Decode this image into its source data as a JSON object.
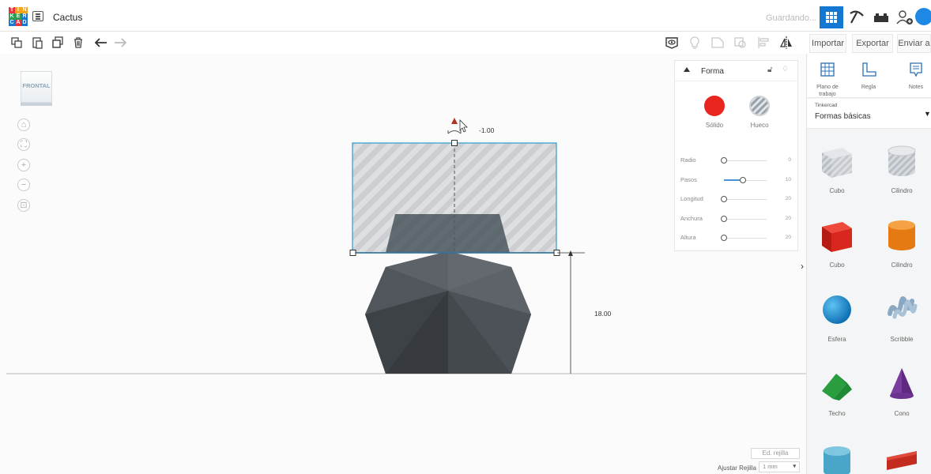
{
  "header": {
    "logo_letters": [
      "T",
      "I",
      "N",
      "K",
      "E",
      "R",
      "C",
      "A",
      "D"
    ],
    "logo_colors": [
      "#e8343a",
      "#f6a21b",
      "#f6a21b",
      "#2f9d52",
      "#2f9d52",
      "#1477d1",
      "#1477d1",
      "#e8343a",
      "#1477d1"
    ],
    "project_title": "Cactus",
    "status": "Guardando...",
    "accent_color": "#1477d1"
  },
  "toolbar": {
    "left_icons": [
      "copy-icon",
      "paste-icon",
      "duplicate-icon",
      "delete-icon",
      "undo-icon",
      "redo-icon"
    ],
    "right_icons": [
      "visibility-icon",
      "light-icon",
      "group-icon",
      "ungroup-icon",
      "align-icon",
      "mirror-icon"
    ],
    "import_label": "Importar",
    "export_label": "Exportar",
    "send_label": "Enviar a"
  },
  "viewport": {
    "view_cube_label": "FRONTAL",
    "nav_buttons": [
      "home-icon",
      "fit-icon",
      "zoom-in-icon",
      "zoom-out-icon",
      "perspective-icon"
    ],
    "rotation_value": "-1.00",
    "height_value": "18.00",
    "edit_grid_label": "Ed. rejilla",
    "snap_label": "Ajustar Rejilla",
    "snap_value": "1 mm"
  },
  "inspector": {
    "title": "Forma",
    "solid_label": "Sólido",
    "hole_label": "Hueco",
    "solid_color": "#e8251f",
    "properties": [
      {
        "label": "Radio",
        "value": "0",
        "level": 0
      },
      {
        "label": "Pasos",
        "value": "10",
        "level": 0.45
      },
      {
        "label": "Longitud",
        "value": "20",
        "level": 0
      },
      {
        "label": "Anchura",
        "value": "20",
        "level": 0
      },
      {
        "label": "Altura",
        "value": "20",
        "level": 0
      }
    ]
  },
  "panel": {
    "tools": [
      {
        "label": "Plano de trabajo",
        "icon": "workplane-icon"
      },
      {
        "label": "Regla",
        "icon": "ruler-icon"
      },
      {
        "label": "Notes",
        "icon": "notes-icon"
      }
    ],
    "library_source": "Tinkercad",
    "library_name": "Formas básicas",
    "shapes": [
      {
        "label": "Cubo",
        "icon": "hole-box-icon"
      },
      {
        "label": "Cilindro",
        "icon": "hole-cylinder-icon"
      },
      {
        "label": "Cubo",
        "icon": "box-icon"
      },
      {
        "label": "Cilindro",
        "icon": "cylinder-icon"
      },
      {
        "label": "Esfera",
        "icon": "sphere-icon"
      },
      {
        "label": "Scribble",
        "icon": "scribble-icon"
      },
      {
        "label": "Techo",
        "icon": "roof-icon"
      },
      {
        "label": "Cono",
        "icon": "cone-icon"
      }
    ]
  }
}
